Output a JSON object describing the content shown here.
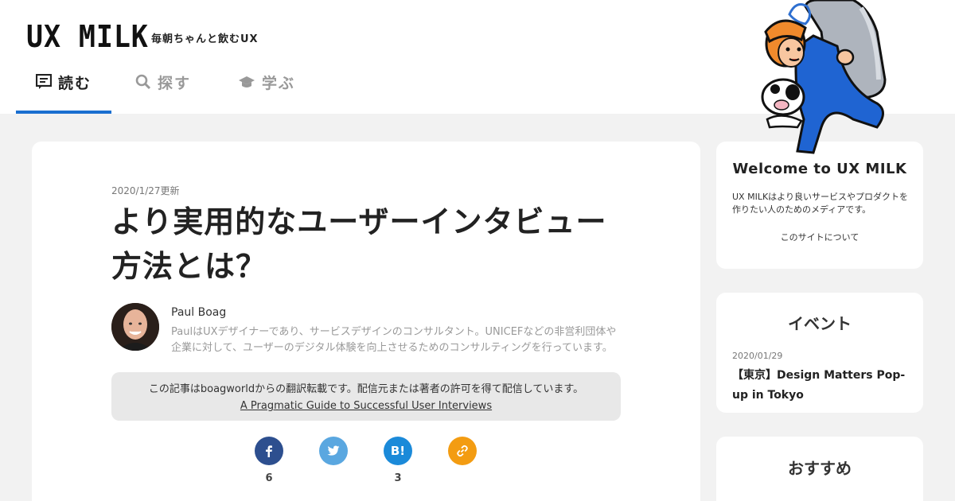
{
  "header": {
    "logo": "UX MILK",
    "tagline": "毎朝ちゃんと飲むUX",
    "nav": [
      {
        "label": "読む",
        "icon": "article-icon",
        "active": true
      },
      {
        "label": "探す",
        "icon": "search-icon",
        "active": false
      },
      {
        "label": "学ぶ",
        "icon": "graduation-cap-icon",
        "active": false
      }
    ],
    "accent_color": "#1a6fd0"
  },
  "article": {
    "updated": "2020/1/27更新",
    "title": "より実用的なユーザーインタビュー方法とは？",
    "author": {
      "name": "Paul Boag",
      "bio": "PaulはUXデザイナーであり、サービスデザインのコンサルタント。UNICEFなどの非営利団体や企業に対して、ユーザーのデジタル体験を向上させるためのコンサルティングを行っています。"
    },
    "notice": {
      "text": "この記事はboagworldからの翻訳転載です。配信元または著者の許可を得て配信しています。",
      "link": "A Pragmatic Guide to Successful User Interviews"
    },
    "share": [
      {
        "name": "facebook",
        "glyph": "f",
        "count": "6",
        "color": "#2d4f8f"
      },
      {
        "name": "twitter",
        "glyph": "🐦",
        "count": "",
        "color": "#5aa7e0"
      },
      {
        "name": "hatena",
        "glyph": "B!",
        "count": "3",
        "color": "#1b8ad9"
      },
      {
        "name": "link",
        "glyph": "🔗",
        "count": "",
        "color": "#f39c12"
      }
    ]
  },
  "sidebar": {
    "welcome": {
      "title": "Welcome to UX MILK",
      "desc": "UX MILKはより良いサービスやプロダクトを作りたい人のためのメディアです。",
      "link": "このサイトについて"
    },
    "events": {
      "title": "イベント",
      "date": "2020/01/29",
      "event": "【東京】Design Matters Pop-up in Tokyo"
    },
    "recommend": {
      "title": "おすすめ"
    }
  }
}
